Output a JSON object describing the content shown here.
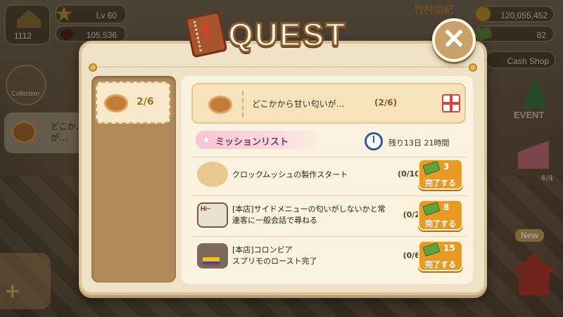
{
  "hud": {
    "level": "Lv 60",
    "exp": "105,536",
    "house_count": "1112",
    "coins": "120,055,452",
    "cash": "82",
    "shop_label": "Cash Shop",
    "shop_sign": "竹村由紀"
  },
  "side": {
    "collection_label": "Collection",
    "quest_preview": "どこか…\nが…",
    "event_label": "EVENT",
    "cake_count": "4/4",
    "new_badge": "New"
  },
  "quest": {
    "title": "QUEST",
    "close_symbol": "✕",
    "left_item": {
      "progress": "2/6"
    },
    "header": {
      "name": "どこかから甘い匂いが…",
      "progress": "(2/6)"
    },
    "mission_list_label": "ミッションリスト",
    "time_remaining": "残り13日 21時間",
    "missions": [
      {
        "description": "クロックムッシュの製作スタート",
        "progress": "(0/10)",
        "reward": "3",
        "button_label": "完了する",
        "thumb_text": ""
      },
      {
        "description": "[本店]サイドメニューの匂いがしないかと常連客に一般会話で尋ねる",
        "progress": "(0/2)",
        "reward": "8",
        "button_label": "完了する",
        "thumb_text": "Hi~"
      },
      {
        "description": "[本店]コロンビア\nスプリモのロースト完了",
        "progress": "(0/6)",
        "reward": "15",
        "button_label": "完了する",
        "thumb_text": ""
      }
    ]
  }
}
